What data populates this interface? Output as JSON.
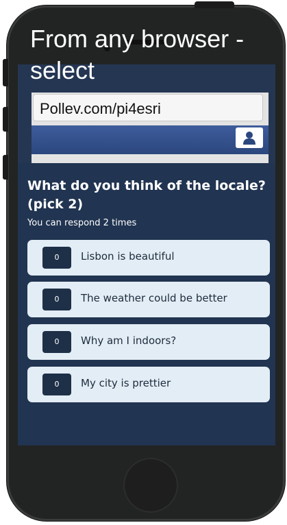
{
  "overlay": {
    "heading": "From any browser - select"
  },
  "browser": {
    "url": "Pollev.com/pi4esri"
  },
  "poll": {
    "question": "What do you think of the locale? (pick 2)",
    "subtitle": "You can respond 2 times",
    "options": [
      {
        "count": "0",
        "label": "Lisbon is beautiful"
      },
      {
        "count": "0",
        "label": "The weather could be better"
      },
      {
        "count": "0",
        "label": "Why am I indoors?"
      },
      {
        "count": "0",
        "label": "My city is prettier"
      }
    ]
  },
  "colors": {
    "panel": "#213451",
    "option_bg": "#e3edf5",
    "count_bg": "#1e3048",
    "nav_bar": "#34508a"
  }
}
